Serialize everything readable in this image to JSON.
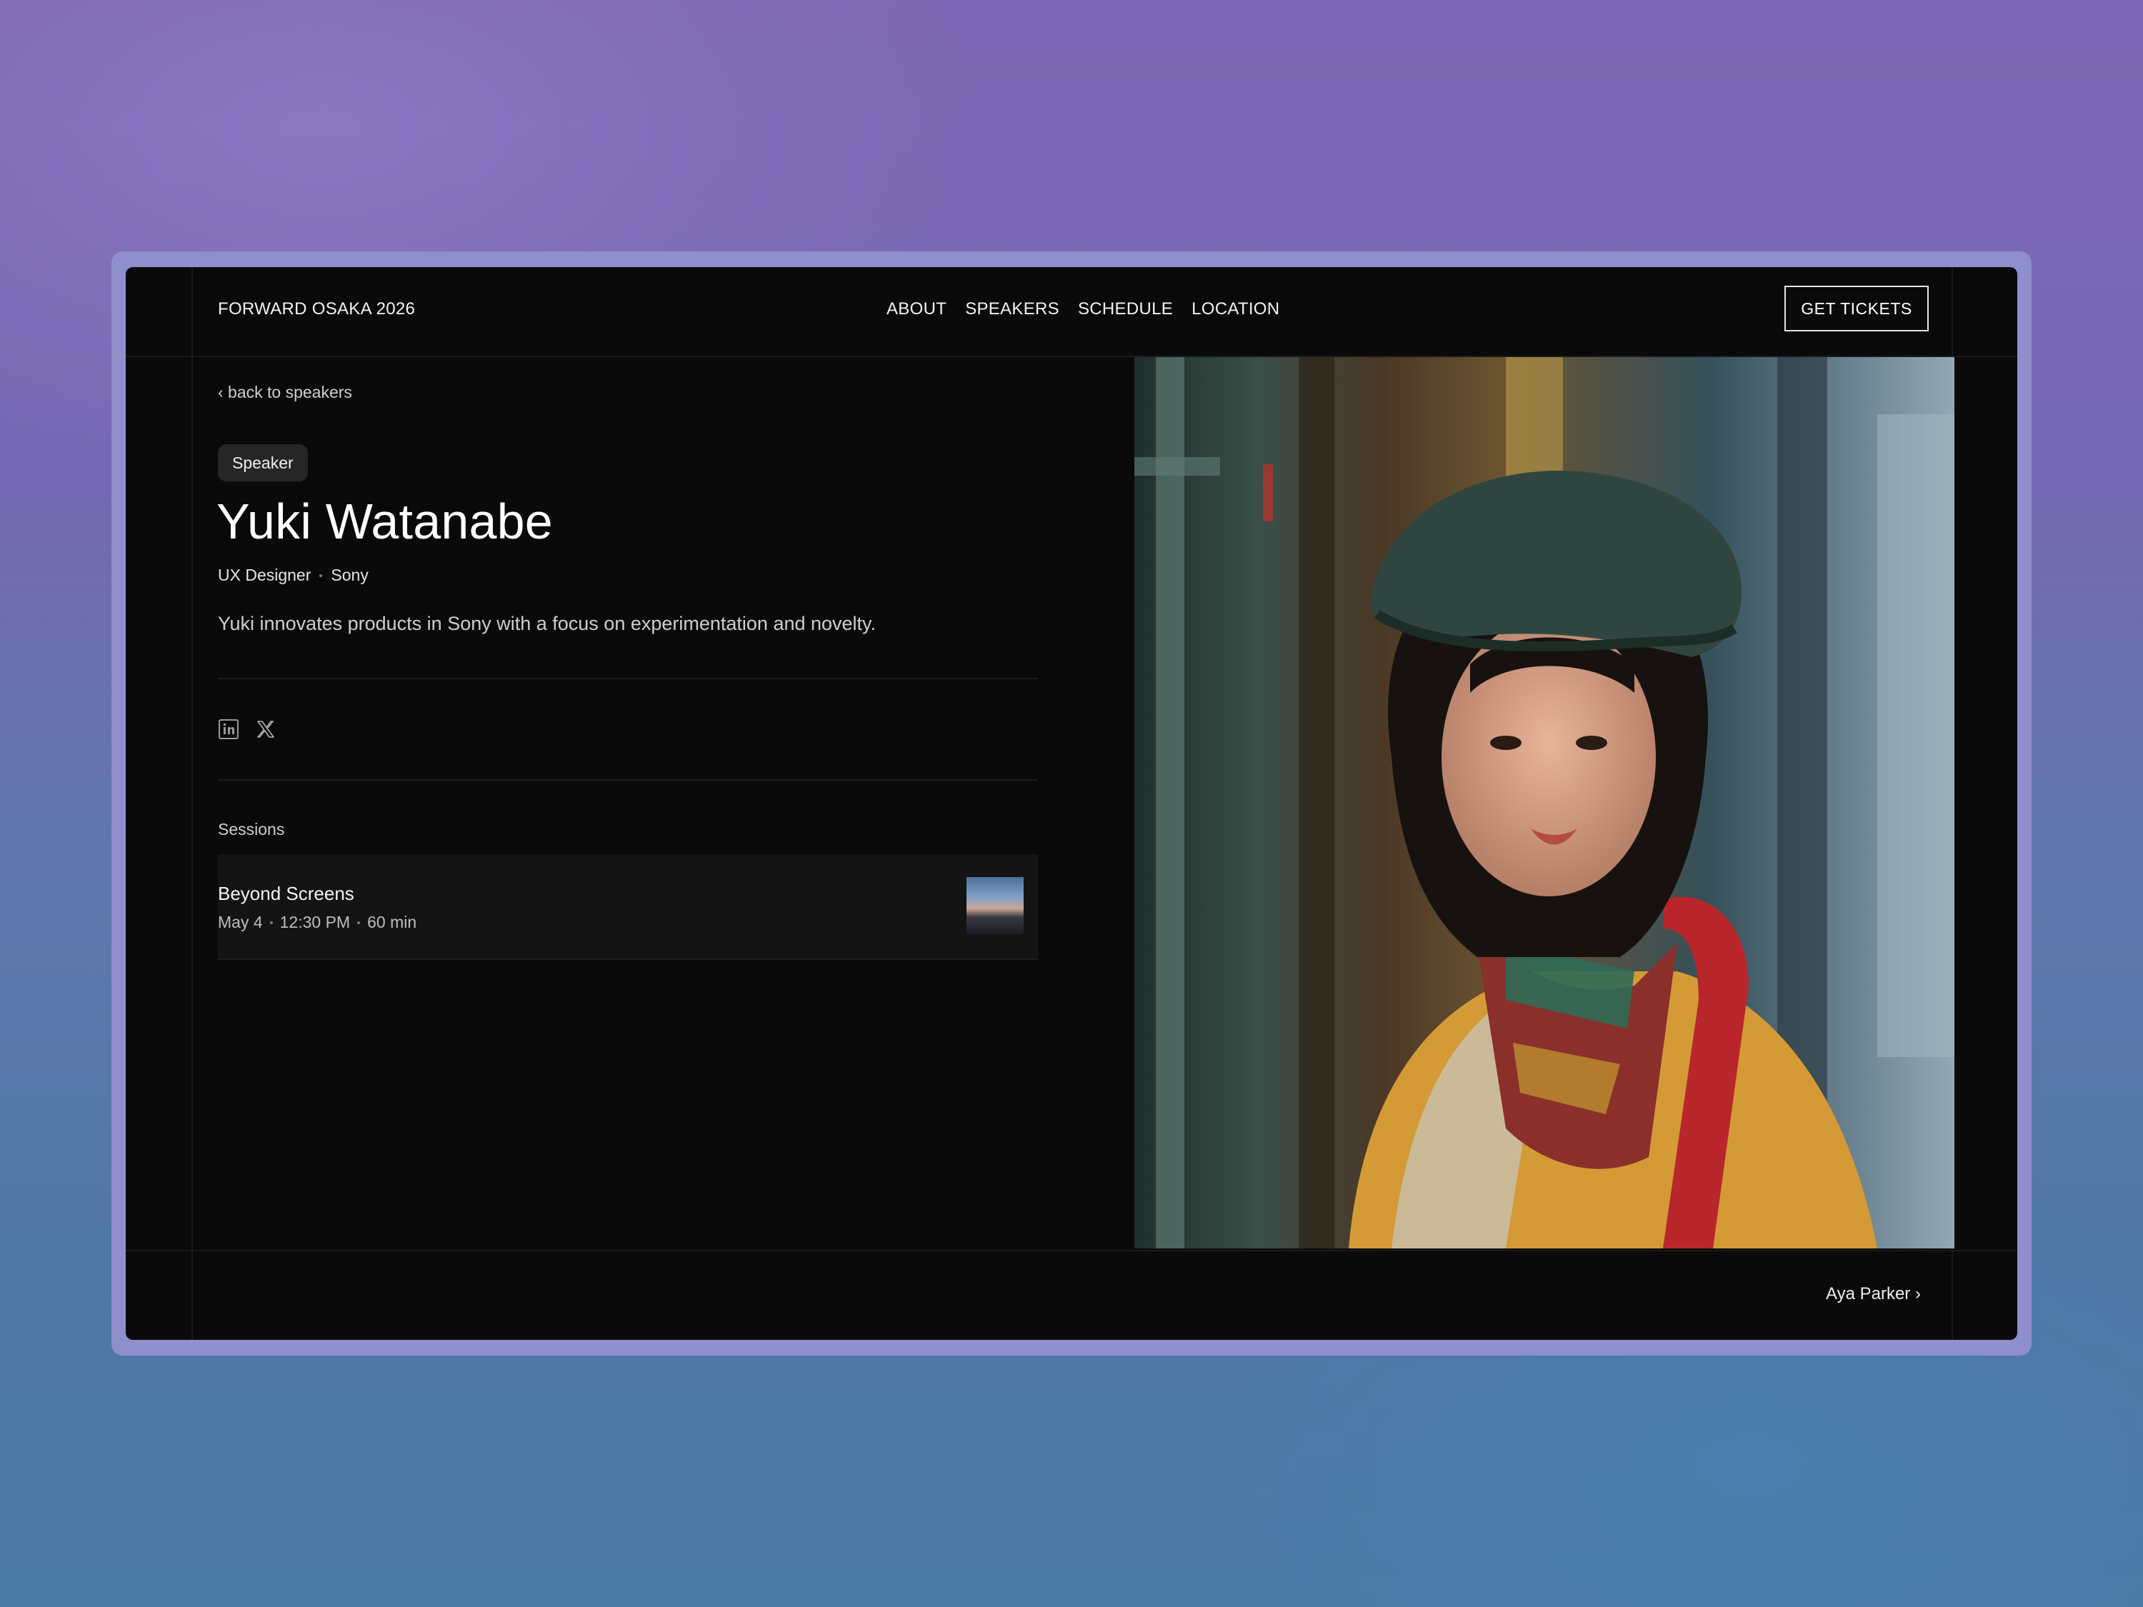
{
  "header": {
    "brand": "FORWARD OSAKA 2026",
    "nav": [
      "ABOUT",
      "SPEAKERS",
      "SCHEDULE",
      "LOCATION"
    ],
    "cta_label": "GET TICKETS"
  },
  "speaker": {
    "back_link": "‹ back to speakers",
    "badge": "Speaker",
    "name": "Yuki Watanabe",
    "role": "UX Designer",
    "company": "Sony",
    "bio": "Yuki innovates products in Sony with a focus on experimentation and novelty.",
    "socials": [
      "linkedin-icon",
      "x-icon"
    ]
  },
  "sessions": {
    "title": "Sessions",
    "items": [
      {
        "title": "Beyond Screens",
        "date": "May 4",
        "time": "12:30 PM",
        "duration": "60 min"
      }
    ]
  },
  "footer": {
    "next_speaker": "Aya Parker ›"
  },
  "colors": {
    "background": "#0a0a0a",
    "text": "#ffffff",
    "muted": "#cfcfcf",
    "badge": "#262626",
    "session_card": "#141414"
  }
}
